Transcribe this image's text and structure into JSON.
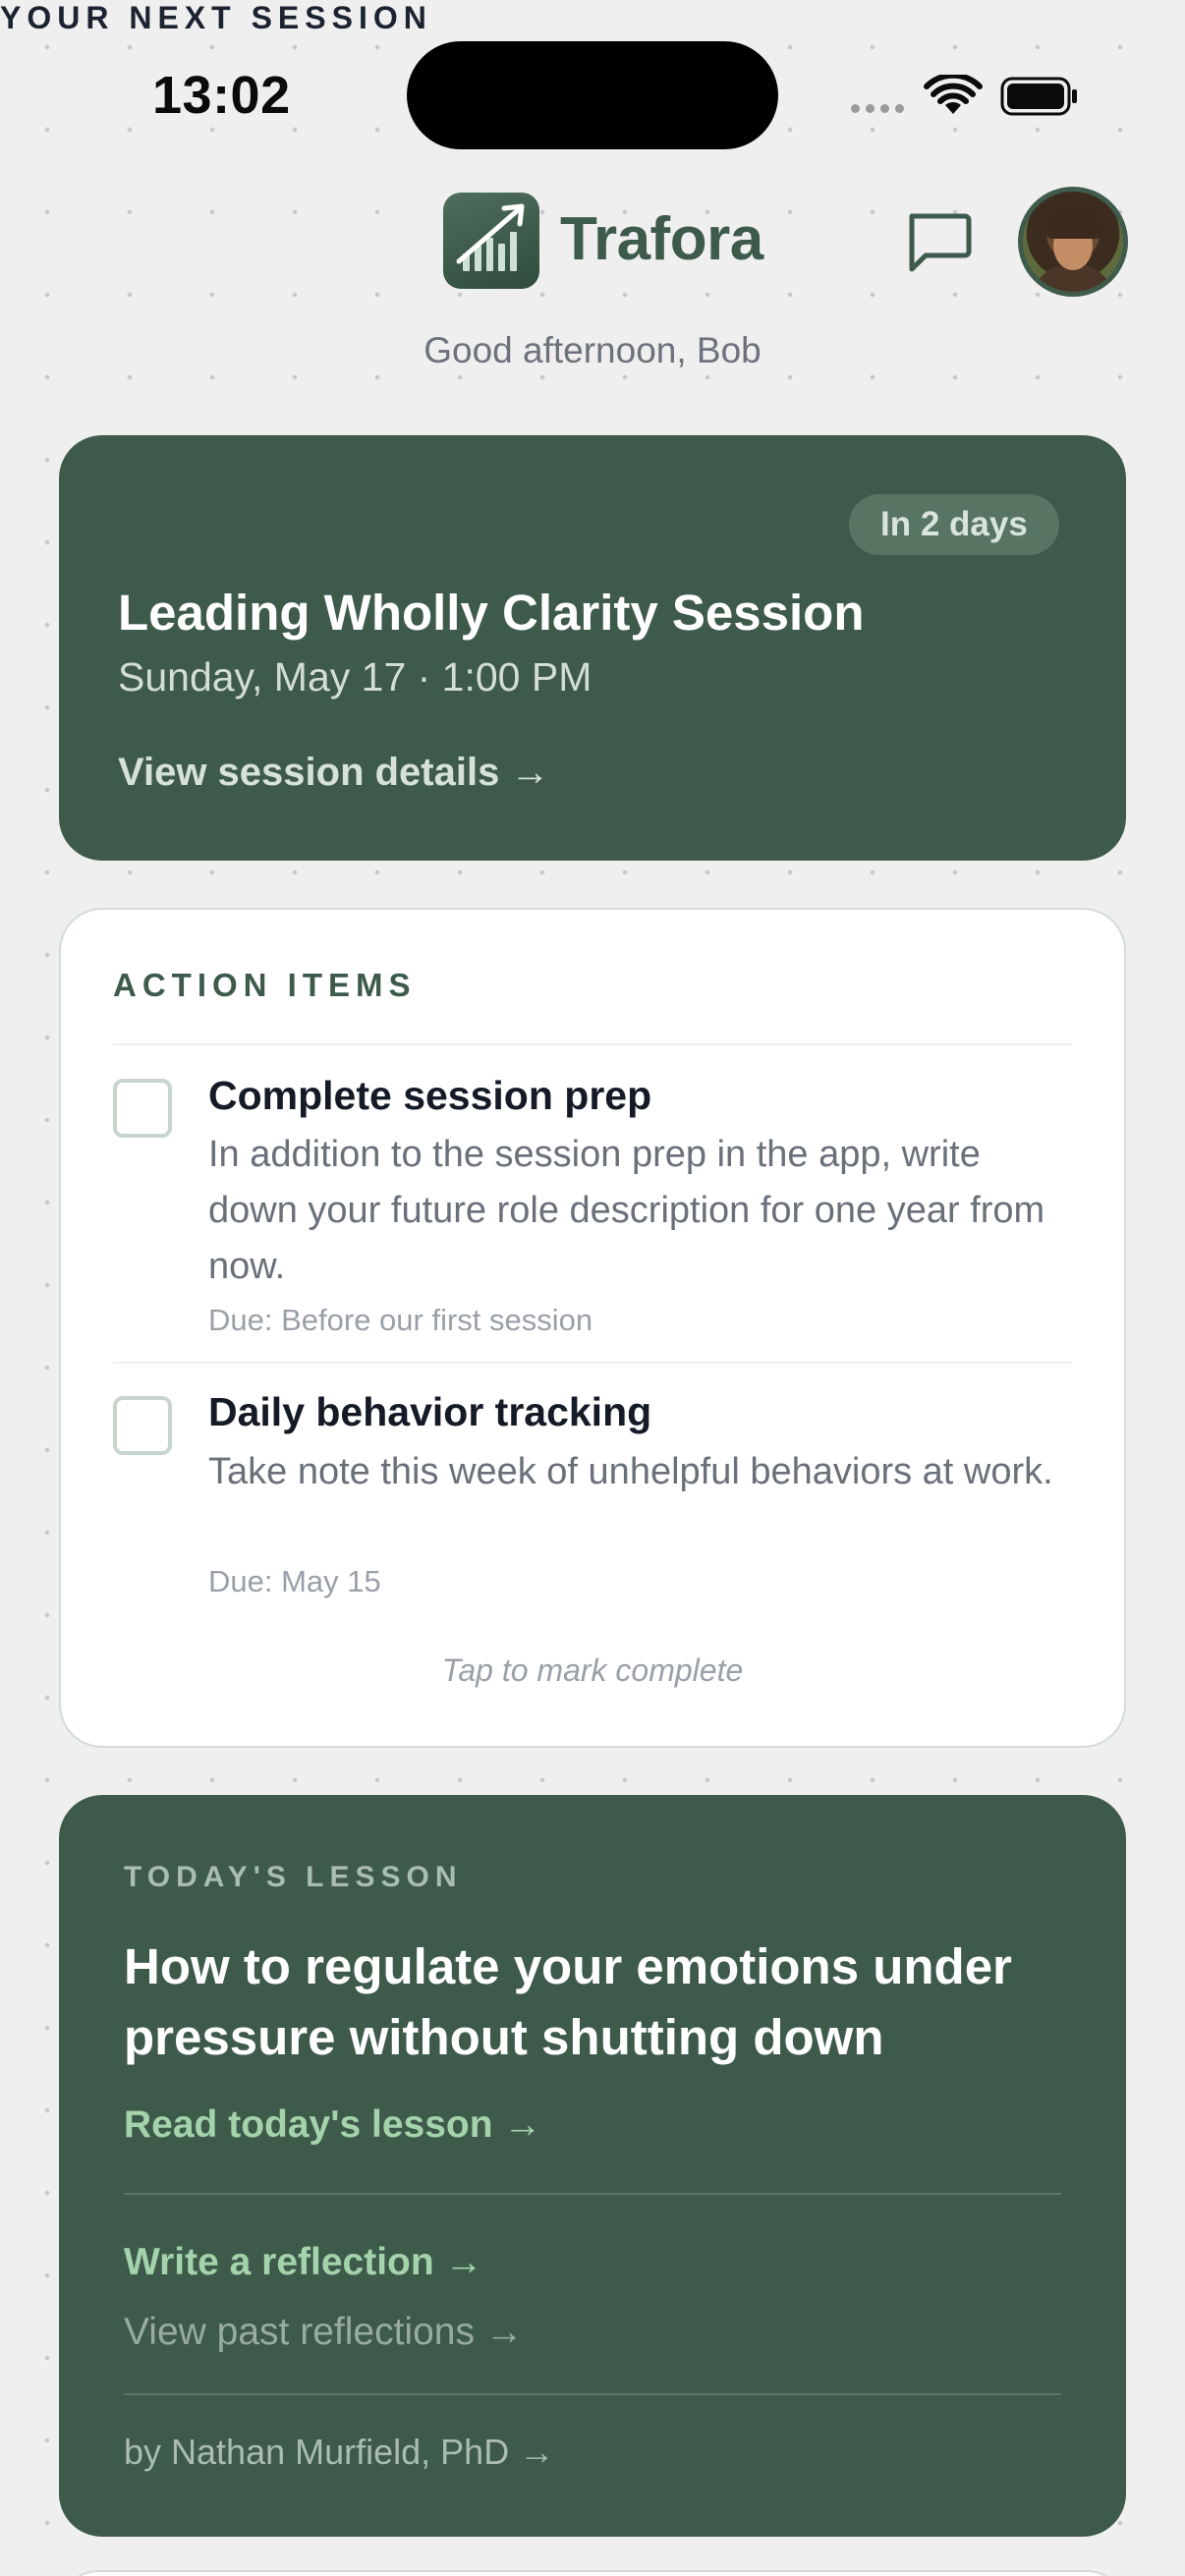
{
  "status_bar": {
    "time": "13:02"
  },
  "header": {
    "app_name": "Trafora",
    "greeting": "Good afternoon, Bob"
  },
  "next_session": {
    "eyebrow": "YOUR NEXT SESSION",
    "badge": "In 2 days",
    "title": "Leading Wholly Clarity Session",
    "when": "Sunday, May 17 · 1:00 PM",
    "link": "View session details →"
  },
  "action_items": {
    "heading": "ACTION ITEMS",
    "items": [
      {
        "title": "Complete session prep",
        "description": "In addition to the session prep in the app, write down your future role description for one year from now.",
        "due": "Due: Before our first session",
        "completed": false
      },
      {
        "title": "Daily behavior tracking",
        "description": "Take note this week of unhelpful behaviors at work.",
        "due": "Due: May 15",
        "completed": false
      }
    ],
    "hint": "Tap to mark complete"
  },
  "lesson": {
    "eyebrow": "TODAY'S LESSON",
    "title": "How to regulate your emotions under pressure without shutting down",
    "read_link": "Read today's lesson →",
    "write_link": "Write a reflection →",
    "past_link": "View past reflections →",
    "author_link": "by Nathan Murfield, PhD →"
  },
  "theme": {
    "primary": "#3e5a4b",
    "accent_link": "#a3d2ab",
    "background": "#efefef"
  },
  "icons": {
    "logo": "chart-trend-up-icon",
    "chat": "chat-bubble-icon",
    "avatar": "user-avatar"
  }
}
